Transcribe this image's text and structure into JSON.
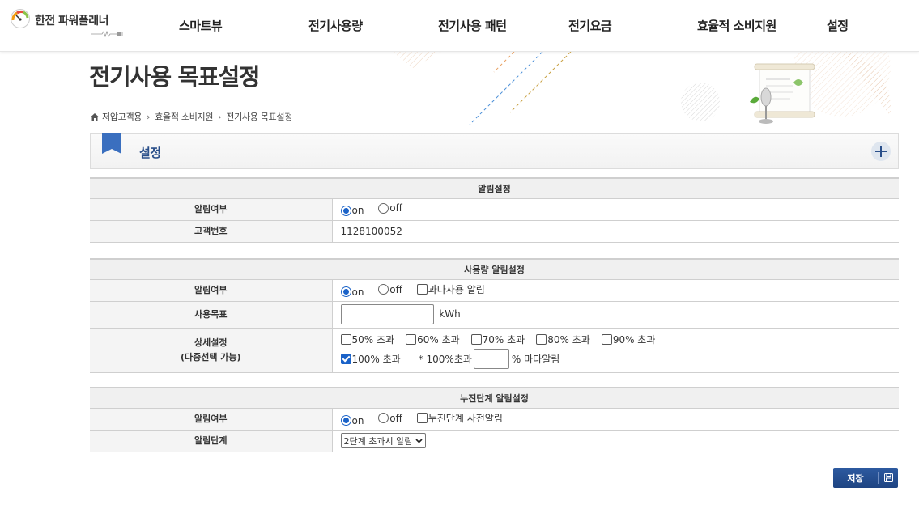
{
  "header": {
    "logo_text": "한전 파워플래너",
    "nav": [
      "스마트뷰",
      "전기사용량",
      "전기사용 패턴",
      "전기요금",
      "효율적 소비지원",
      "설정"
    ]
  },
  "page": {
    "title": "전기사용 목표설정",
    "breadcrumb": [
      "저압고객용",
      "효율적 소비지원",
      "전기사용 목표설정"
    ]
  },
  "section": {
    "title": "설정"
  },
  "alarm": {
    "heading": "알림설정",
    "enabled_label": "알림여부",
    "on_label": "on",
    "off_label": "off",
    "selected": "on",
    "customer_label": "고객번호",
    "customer_no": "1128100052"
  },
  "usage": {
    "heading": "사용량 알림설정",
    "enabled_label": "알림여부",
    "on_label": "on",
    "off_label": "off",
    "selected": "on",
    "overuse_label": "과다사용 알림",
    "overuse_checked": false,
    "target_label": "사용목표",
    "target_value": "",
    "target_unit": "kWh",
    "detail_label_1": "상세설정",
    "detail_label_2": "(다중선택 가능)",
    "thresholds": [
      {
        "label": "50% 초과",
        "checked": false
      },
      {
        "label": "60% 초과",
        "checked": false
      },
      {
        "label": "70% 초과",
        "checked": false
      },
      {
        "label": "80% 초과",
        "checked": false
      },
      {
        "label": "90% 초과",
        "checked": false
      },
      {
        "label": "100% 초과",
        "checked": true
      }
    ],
    "repeat_prefix": "* 100%초과",
    "repeat_value": "",
    "repeat_suffix": "% 마다알림"
  },
  "progressive": {
    "heading": "누진단계 알림설정",
    "enabled_label": "알림여부",
    "on_label": "on",
    "off_label": "off",
    "selected": "on",
    "pre_alarm_label": "누진단계 사전알림",
    "pre_alarm_checked": false,
    "stage_label": "알림단계",
    "stage_selected": "2단계 초과시 알림"
  },
  "actions": {
    "save_label": "저장"
  },
  "colors": {
    "accent": "#1a62c8",
    "section_title": "#2a4f8a",
    "button": "#2d5aa0"
  }
}
